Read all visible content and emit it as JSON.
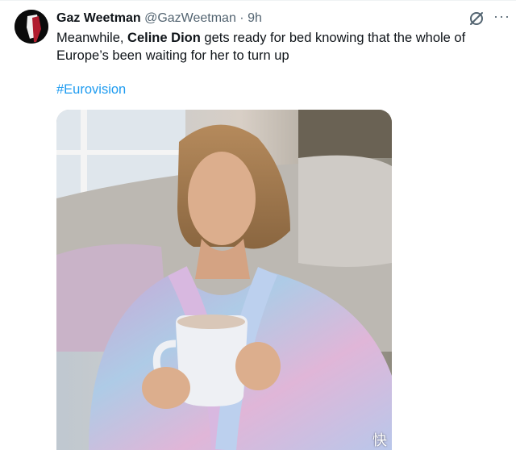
{
  "author": {
    "display_name": "Gaz Weetman",
    "handle": "@GazWeetman",
    "separator": "·",
    "time": "9h"
  },
  "tweet": {
    "text_before": "Meanwhile, ",
    "text_bold": "Celine Dion",
    "text_after": " gets ready for bed knowing that the whole of Europe’s been waiting for her to turn up",
    "hashtag": "#Eurovision"
  },
  "icons": {
    "grok": "grok-icon",
    "more": "more-options-icon"
  },
  "media": {
    "description": "photo-woman-in-pastel-robe-holding-mug"
  },
  "watermark": {
    "text": "快"
  },
  "colors": {
    "link": "#1d9bf0",
    "muted": "#536471",
    "text": "#0f1419"
  }
}
